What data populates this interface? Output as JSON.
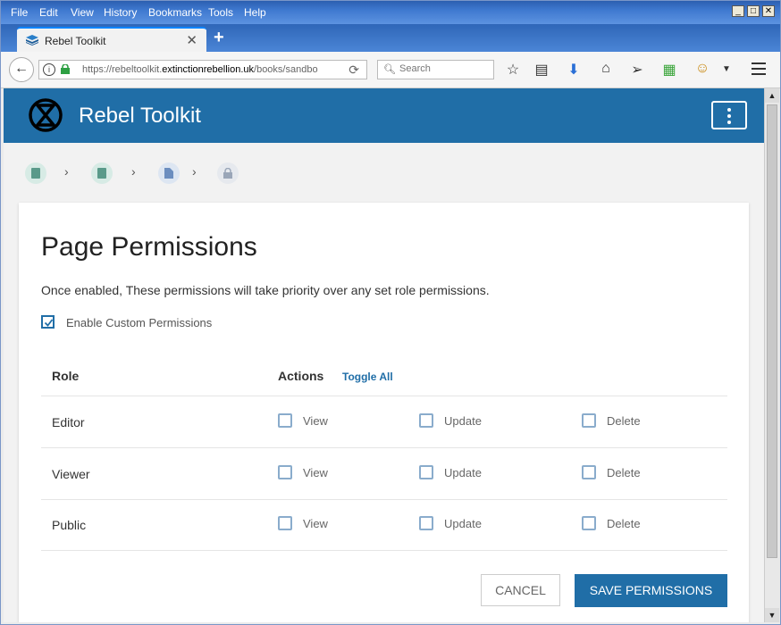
{
  "browser": {
    "menu": [
      "File",
      "Edit",
      "View",
      "History",
      "Bookmarks",
      "Tools",
      "Help"
    ],
    "tab_title": "Rebel Toolkit",
    "url_prefix": "https://rebeltoolkit.",
    "url_domain": "extinctionrebellion.uk",
    "url_suffix": "/books/sandbo",
    "search_placeholder": "Search",
    "window_controls": [
      "_",
      "□",
      "✕"
    ]
  },
  "site": {
    "title": "Rebel Toolkit",
    "brand_color": "#206ea7"
  },
  "breadcrumb": {
    "icons": [
      "book-icon",
      "book-icon",
      "page-icon",
      "lock-icon"
    ],
    "colors": [
      "#5a9a8a",
      "#5a9a8a",
      "#6c8ebf",
      "#9aa6b8"
    ]
  },
  "main": {
    "heading": "Page Permissions",
    "description": "Once enabled, These permissions will take priority over any set role permissions.",
    "enable_label": "Enable Custom Permissions",
    "enable_checked": true,
    "table": {
      "col_role": "Role",
      "col_actions": "Actions",
      "toggle_all": "Toggle All",
      "rows": [
        {
          "role": "Editor",
          "view": "View",
          "update": "Update",
          "delete": "Delete"
        },
        {
          "role": "Viewer",
          "view": "View",
          "update": "Update",
          "delete": "Delete"
        },
        {
          "role": "Public",
          "view": "View",
          "update": "Update",
          "delete": "Delete"
        }
      ]
    },
    "cancel_label": "CANCEL",
    "save_label": "SAVE PERMISSIONS"
  }
}
